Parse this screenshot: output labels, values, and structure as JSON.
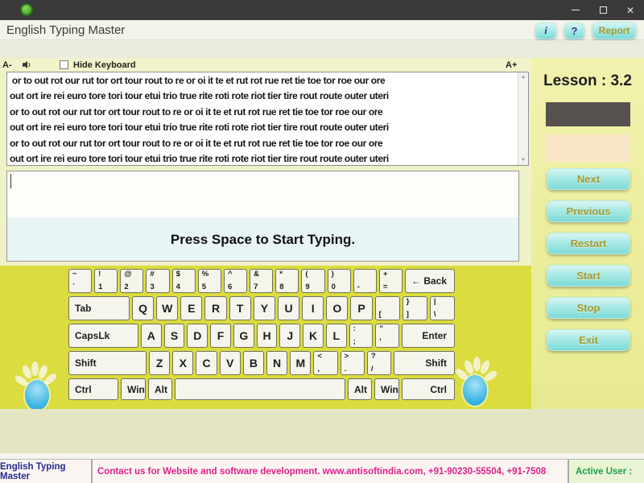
{
  "window": {
    "app_title": "English Typing Master",
    "icons": {
      "minimize": "minimize",
      "maximize": "maximize",
      "close": "✕",
      "app_icon": "green-dot"
    },
    "header_buttons": {
      "info": "i",
      "help": "?",
      "report": "Report"
    }
  },
  "toolbar": {
    "font_decrease": "A-",
    "font_increase": "A+",
    "hide_keyboard_label": "Hide Keyboard",
    "hide_keyboard_checked": false,
    "volume_icon": "speaker"
  },
  "practice_text": {
    "lines": [
      " or to out rot our rut tor ort tour rout to re or oi it te et rut rot rue ret tie toe tor roe our ore",
      "out ort ire rei euro tore tori tour etui trio true rite roti rote riot tier tire rout route outer uteri",
      "or to out rot our rut tor ort tour rout to re or oi it te et rut rot rue ret tie toe tor roe our ore",
      "out ort ire rei euro tore tori tour etui trio true rite roti rote riot tier tire rout route outer uteri",
      "or to out rot our rut tor ort tour rout to re or oi it te et rut rot rue ret tie toe tor roe our ore",
      "out ort ire rei euro tore tori tour etui trio true rite roti rote riot tier tire rout route outer uteri"
    ]
  },
  "typing_area": {
    "value": "",
    "prompt": "Press Space to Start Typing."
  },
  "side_panel": {
    "lesson_label": "Lesson : 3.2",
    "buttons": [
      "Next",
      "Previous",
      "Restart",
      "Start",
      "Stop",
      "Exit"
    ]
  },
  "keyboard": {
    "rows": [
      [
        {
          "n": "backquote",
          "t": "~",
          "b": "`"
        },
        {
          "n": "1",
          "t": "!",
          "b": "1"
        },
        {
          "n": "2",
          "t": "@",
          "b": "2"
        },
        {
          "n": "3",
          "t": "#",
          "b": "3"
        },
        {
          "n": "4",
          "t": "$",
          "b": "4"
        },
        {
          "n": "5",
          "t": "%",
          "b": "5"
        },
        {
          "n": "6",
          "t": "^",
          "b": "6"
        },
        {
          "n": "7",
          "t": "&",
          "b": "7"
        },
        {
          "n": "8",
          "t": "*",
          "b": "8"
        },
        {
          "n": "9",
          "t": "(",
          "b": "9"
        },
        {
          "n": "0",
          "t": ")",
          "b": "0"
        },
        {
          "n": "minus",
          "t": "",
          "b": "-"
        },
        {
          "n": "equals",
          "t": "+",
          "b": "="
        },
        {
          "n": "back",
          "l": "← Back"
        }
      ],
      [
        {
          "n": "tab",
          "l": "Tab"
        },
        {
          "n": "q",
          "l": "Q"
        },
        {
          "n": "w",
          "l": "W"
        },
        {
          "n": "e",
          "l": "E"
        },
        {
          "n": "r",
          "l": "R"
        },
        {
          "n": "t",
          "l": "T"
        },
        {
          "n": "y",
          "l": "Y"
        },
        {
          "n": "u",
          "l": "U"
        },
        {
          "n": "i",
          "l": "I"
        },
        {
          "n": "o",
          "l": "O"
        },
        {
          "n": "p",
          "l": "P"
        },
        {
          "n": "lbracket",
          "t": "",
          "b": "["
        },
        {
          "n": "rbracket",
          "t": "}",
          "b": "]"
        },
        {
          "n": "backslash",
          "t": "|",
          "b": "\\"
        }
      ],
      [
        {
          "n": "caps",
          "l": "CapsLk"
        },
        {
          "n": "a",
          "l": "A"
        },
        {
          "n": "s",
          "l": "S"
        },
        {
          "n": "d",
          "l": "D"
        },
        {
          "n": "f",
          "l": "F"
        },
        {
          "n": "g",
          "l": "G"
        },
        {
          "n": "h",
          "l": "H"
        },
        {
          "n": "j",
          "l": "J"
        },
        {
          "n": "k",
          "l": "K"
        },
        {
          "n": "l",
          "l": "L"
        },
        {
          "n": "semicolon",
          "t": ":",
          "b": ";"
        },
        {
          "n": "quote",
          "t": "\"",
          "b": "'"
        },
        {
          "n": "enter",
          "l": "Enter"
        }
      ],
      [
        {
          "n": "lshift",
          "l": "Shift"
        },
        {
          "n": "z",
          "l": "Z"
        },
        {
          "n": "x",
          "l": "X"
        },
        {
          "n": "c",
          "l": "C"
        },
        {
          "n": "v",
          "l": "V"
        },
        {
          "n": "b",
          "l": "B"
        },
        {
          "n": "n",
          "l": "N"
        },
        {
          "n": "m",
          "l": "M"
        },
        {
          "n": "comma",
          "t": "<",
          "b": ","
        },
        {
          "n": "period",
          "t": ">",
          "b": "."
        },
        {
          "n": "slash",
          "t": "?",
          "b": "/"
        },
        {
          "n": "rshift",
          "l": "Shift"
        }
      ],
      [
        {
          "n": "lctrl",
          "l": "Ctrl"
        },
        {
          "n": "win",
          "l": "Win"
        },
        {
          "n": "alt",
          "l": "Alt"
        },
        {
          "n": "space",
          "l": ""
        },
        {
          "n": "alt2",
          "l": "Alt"
        },
        {
          "n": "win2",
          "l": "Win"
        },
        {
          "n": "rctrl",
          "l": "Ctrl"
        }
      ]
    ]
  },
  "status_bar": {
    "left": "English Typing Master",
    "center": "Contact us for Website and software development. www.antisoftindia.com, +91-90230-55504, +91-7508",
    "right": "Active User :"
  },
  "colors": {
    "accent_button_cyan": "#7cdad6",
    "main_yellow": "#dbdc3e",
    "side_button_text": "#a79b2d",
    "progress_dark_box": "#56504f",
    "progress_peach_box": "#fbe5c9",
    "status_left_text": "#232a8f",
    "status_center_text": "#e01f8b",
    "status_right_text": "#18a04c"
  }
}
